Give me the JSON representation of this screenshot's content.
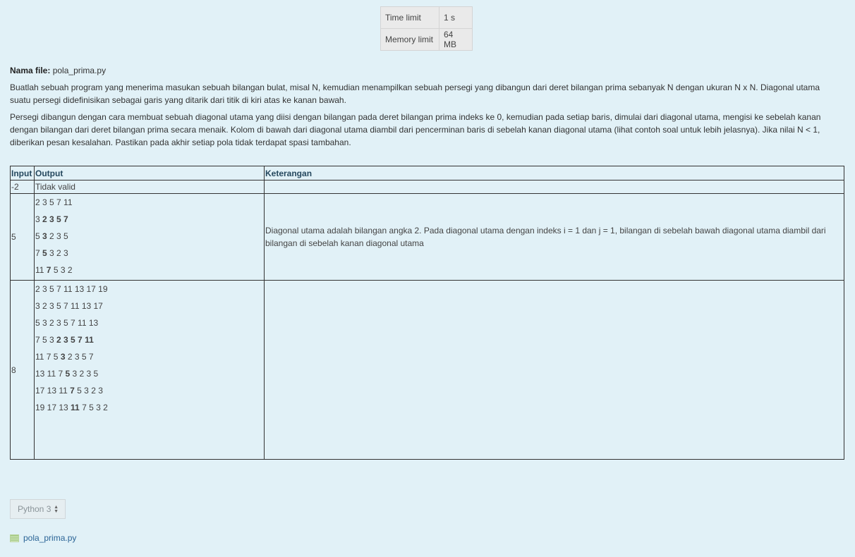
{
  "limits": {
    "time_label": "Time limit",
    "time_value": "1 s",
    "memory_label": "Memory limit",
    "memory_value": "64 MB"
  },
  "description": {
    "filename_label": "Nama file:",
    "filename": "pola_prima.py",
    "paragraph1": "Buatlah sebuah program yang menerima masukan sebuah bilangan bulat, misal N, kemudian menampilkan sebuah persegi yang dibangun dari deret bilangan prima sebanyak N dengan ukuran N x N. Diagonal utama suatu persegi didefinisikan sebagai garis yang ditarik dari titik di kiri atas ke kanan bawah.",
    "paragraph2": "Persegi dibangun dengan cara membuat sebuah diagonal utama yang diisi dengan bilangan pada deret bilangan prima indeks ke 0, kemudian pada setiap baris, dimulai dari diagonal utama, mengisi ke sebelah kanan dengan bilangan dari deret bilangan prima secara menaik. Kolom di bawah dari diagonal utama diambil dari pencerminan baris di sebelah kanan diagonal utama (lihat contoh soal untuk lebih jelasnya). Jika nilai N < 1, diberikan pesan kesalahan. Pastikan pada akhir setiap pola tidak terdapat spasi tambahan."
  },
  "examples": {
    "headers": [
      "Input",
      "Output",
      "Keterangan"
    ],
    "rows": [
      {
        "input": "-2",
        "output": [
          [
            {
              "t": "Tidak valid",
              "b": false
            }
          ]
        ],
        "note": ""
      },
      {
        "input": "5",
        "output": [
          [
            {
              "t": "2 3 5 7 11",
              "b": false
            }
          ],
          [
            {
              "t": "3 ",
              "b": false
            },
            {
              "t": "2 3 5 7",
              "b": true
            }
          ],
          [
            {
              "t": "5 ",
              "b": false
            },
            {
              "t": "3",
              "b": true
            },
            {
              "t": " 2 3 5",
              "b": false
            }
          ],
          [
            {
              "t": "7 ",
              "b": false
            },
            {
              "t": "5",
              "b": true
            },
            {
              "t": " 3 2 3",
              "b": false
            }
          ],
          [
            {
              "t": "11 ",
              "b": false
            },
            {
              "t": "7",
              "b": true
            },
            {
              "t": " 5 3 2",
              "b": false
            }
          ]
        ],
        "note": "Diagonal utama adalah bilangan angka 2. Pada diagonal utama dengan indeks i = 1 dan j = 1, bilangan di sebelah bawah diagonal utama diambil dari bilangan di sebelah kanan diagonal utama"
      },
      {
        "input": "8",
        "output": [
          [
            {
              "t": "2 3 5 7 11 13 17 19",
              "b": false
            }
          ],
          [
            {
              "t": "3 2 3 5 7 11 13 17",
              "b": false
            }
          ],
          [
            {
              "t": "5 3 2 3 5 7 11 13",
              "b": false
            }
          ],
          [
            {
              "t": "7 5 3 ",
              "b": false
            },
            {
              "t": "2 3 5 7 11",
              "b": true
            }
          ],
          [
            {
              "t": "11 7 5 ",
              "b": false
            },
            {
              "t": "3",
              "b": true
            },
            {
              "t": " 2 3 5 7",
              "b": false
            }
          ],
          [
            {
              "t": "13 11 7 ",
              "b": false
            },
            {
              "t": "5",
              "b": true
            },
            {
              "t": " 3 2 3 5",
              "b": false
            }
          ],
          [
            {
              "t": "17 13 11 ",
              "b": false
            },
            {
              "t": "7",
              "b": true
            },
            {
              "t": " 5 3 2 3",
              "b": false
            }
          ],
          [
            {
              "t": "19 17 13 ",
              "b": false
            },
            {
              "t": "11",
              "b": true
            },
            {
              "t": " 7 5 3 2",
              "b": false
            }
          ]
        ],
        "note": ""
      }
    ]
  },
  "language_select": {
    "value": "Python 3",
    "arrow_icon": "updown-arrow-icon"
  },
  "file_link": {
    "label": "pola_prima.py",
    "icon": "file-icon"
  }
}
